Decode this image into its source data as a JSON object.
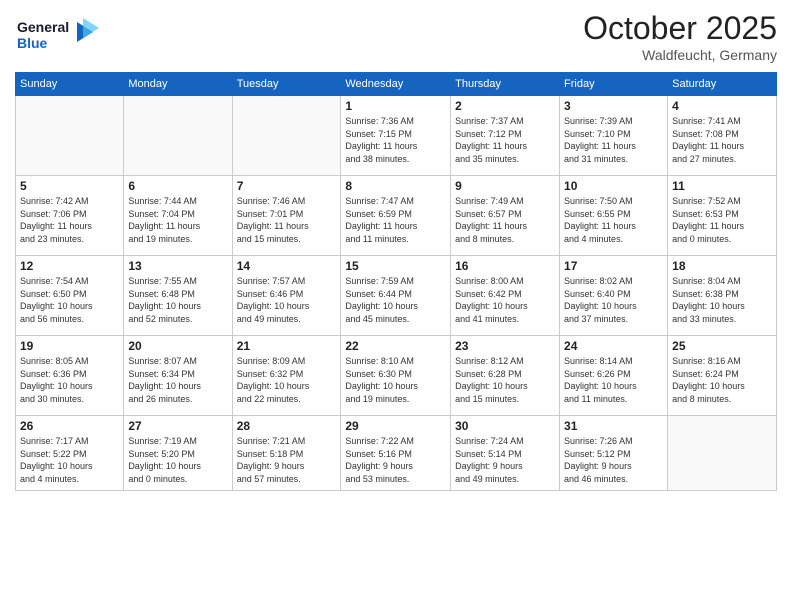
{
  "header": {
    "logo_line1": "General",
    "logo_line2": "Blue",
    "month": "October 2025",
    "location": "Waldfeucht, Germany"
  },
  "weekdays": [
    "Sunday",
    "Monday",
    "Tuesday",
    "Wednesday",
    "Thursday",
    "Friday",
    "Saturday"
  ],
  "weeks": [
    [
      {
        "day": "",
        "info": ""
      },
      {
        "day": "",
        "info": ""
      },
      {
        "day": "",
        "info": ""
      },
      {
        "day": "1",
        "info": "Sunrise: 7:36 AM\nSunset: 7:15 PM\nDaylight: 11 hours\nand 38 minutes."
      },
      {
        "day": "2",
        "info": "Sunrise: 7:37 AM\nSunset: 7:12 PM\nDaylight: 11 hours\nand 35 minutes."
      },
      {
        "day": "3",
        "info": "Sunrise: 7:39 AM\nSunset: 7:10 PM\nDaylight: 11 hours\nand 31 minutes."
      },
      {
        "day": "4",
        "info": "Sunrise: 7:41 AM\nSunset: 7:08 PM\nDaylight: 11 hours\nand 27 minutes."
      }
    ],
    [
      {
        "day": "5",
        "info": "Sunrise: 7:42 AM\nSunset: 7:06 PM\nDaylight: 11 hours\nand 23 minutes."
      },
      {
        "day": "6",
        "info": "Sunrise: 7:44 AM\nSunset: 7:04 PM\nDaylight: 11 hours\nand 19 minutes."
      },
      {
        "day": "7",
        "info": "Sunrise: 7:46 AM\nSunset: 7:01 PM\nDaylight: 11 hours\nand 15 minutes."
      },
      {
        "day": "8",
        "info": "Sunrise: 7:47 AM\nSunset: 6:59 PM\nDaylight: 11 hours\nand 11 minutes."
      },
      {
        "day": "9",
        "info": "Sunrise: 7:49 AM\nSunset: 6:57 PM\nDaylight: 11 hours\nand 8 minutes."
      },
      {
        "day": "10",
        "info": "Sunrise: 7:50 AM\nSunset: 6:55 PM\nDaylight: 11 hours\nand 4 minutes."
      },
      {
        "day": "11",
        "info": "Sunrise: 7:52 AM\nSunset: 6:53 PM\nDaylight: 11 hours\nand 0 minutes."
      }
    ],
    [
      {
        "day": "12",
        "info": "Sunrise: 7:54 AM\nSunset: 6:50 PM\nDaylight: 10 hours\nand 56 minutes."
      },
      {
        "day": "13",
        "info": "Sunrise: 7:55 AM\nSunset: 6:48 PM\nDaylight: 10 hours\nand 52 minutes."
      },
      {
        "day": "14",
        "info": "Sunrise: 7:57 AM\nSunset: 6:46 PM\nDaylight: 10 hours\nand 49 minutes."
      },
      {
        "day": "15",
        "info": "Sunrise: 7:59 AM\nSunset: 6:44 PM\nDaylight: 10 hours\nand 45 minutes."
      },
      {
        "day": "16",
        "info": "Sunrise: 8:00 AM\nSunset: 6:42 PM\nDaylight: 10 hours\nand 41 minutes."
      },
      {
        "day": "17",
        "info": "Sunrise: 8:02 AM\nSunset: 6:40 PM\nDaylight: 10 hours\nand 37 minutes."
      },
      {
        "day": "18",
        "info": "Sunrise: 8:04 AM\nSunset: 6:38 PM\nDaylight: 10 hours\nand 33 minutes."
      }
    ],
    [
      {
        "day": "19",
        "info": "Sunrise: 8:05 AM\nSunset: 6:36 PM\nDaylight: 10 hours\nand 30 minutes."
      },
      {
        "day": "20",
        "info": "Sunrise: 8:07 AM\nSunset: 6:34 PM\nDaylight: 10 hours\nand 26 minutes."
      },
      {
        "day": "21",
        "info": "Sunrise: 8:09 AM\nSunset: 6:32 PM\nDaylight: 10 hours\nand 22 minutes."
      },
      {
        "day": "22",
        "info": "Sunrise: 8:10 AM\nSunset: 6:30 PM\nDaylight: 10 hours\nand 19 minutes."
      },
      {
        "day": "23",
        "info": "Sunrise: 8:12 AM\nSunset: 6:28 PM\nDaylight: 10 hours\nand 15 minutes."
      },
      {
        "day": "24",
        "info": "Sunrise: 8:14 AM\nSunset: 6:26 PM\nDaylight: 10 hours\nand 11 minutes."
      },
      {
        "day": "25",
        "info": "Sunrise: 8:16 AM\nSunset: 6:24 PM\nDaylight: 10 hours\nand 8 minutes."
      }
    ],
    [
      {
        "day": "26",
        "info": "Sunrise: 7:17 AM\nSunset: 5:22 PM\nDaylight: 10 hours\nand 4 minutes."
      },
      {
        "day": "27",
        "info": "Sunrise: 7:19 AM\nSunset: 5:20 PM\nDaylight: 10 hours\nand 0 minutes."
      },
      {
        "day": "28",
        "info": "Sunrise: 7:21 AM\nSunset: 5:18 PM\nDaylight: 9 hours\nand 57 minutes."
      },
      {
        "day": "29",
        "info": "Sunrise: 7:22 AM\nSunset: 5:16 PM\nDaylight: 9 hours\nand 53 minutes."
      },
      {
        "day": "30",
        "info": "Sunrise: 7:24 AM\nSunset: 5:14 PM\nDaylight: 9 hours\nand 49 minutes."
      },
      {
        "day": "31",
        "info": "Sunrise: 7:26 AM\nSunset: 5:12 PM\nDaylight: 9 hours\nand 46 minutes."
      },
      {
        "day": "",
        "info": ""
      }
    ]
  ]
}
